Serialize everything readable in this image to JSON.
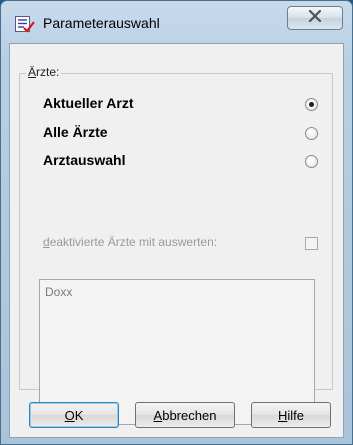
{
  "window": {
    "title": "Parameterauswahl",
    "icon": "parameter-list-icon",
    "close_icon": "close-icon"
  },
  "group": {
    "label_underlined": "Ä",
    "label_rest": "rzte:"
  },
  "radios": [
    {
      "label": "Aktueller Arzt",
      "checked": true
    },
    {
      "label": "Alle Ärzte",
      "checked": false
    },
    {
      "label": "Arztauswahl",
      "checked": false
    }
  ],
  "deactivated": {
    "label_underlined": "d",
    "label_rest": "eaktivierte Ärzte mit auswerten:",
    "checked": false,
    "enabled": false
  },
  "list": {
    "items": [
      "Doxx"
    ]
  },
  "buttons": {
    "ok": {
      "underlined": "O",
      "rest": "K"
    },
    "cancel": {
      "underlined": "A",
      "rest": "bbrechen"
    },
    "help": {
      "underlined": "H",
      "rest": "ilfe"
    }
  },
  "colors": {
    "desktop": "#1b5a86",
    "frame": "#b8cfe3",
    "client": "#f0f0f0"
  }
}
